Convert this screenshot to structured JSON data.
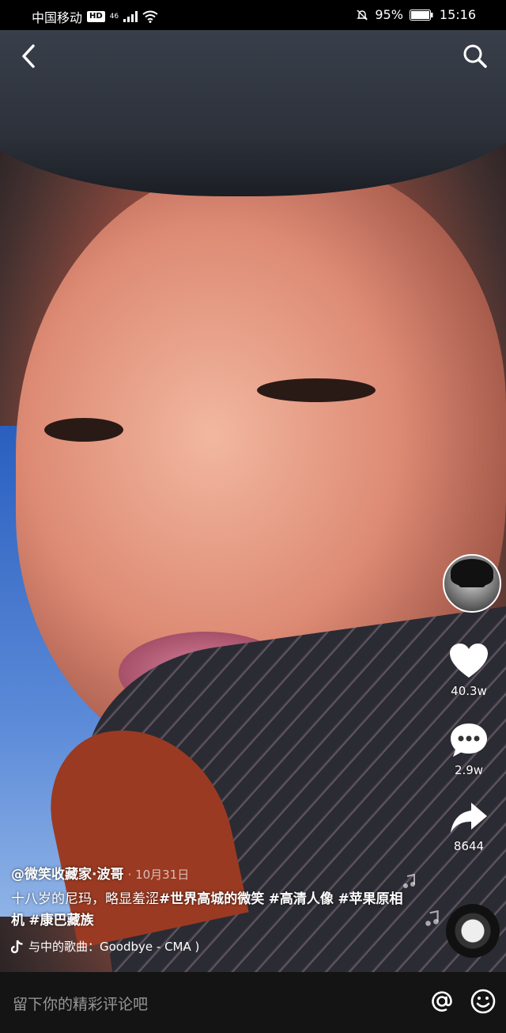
{
  "status_bar": {
    "carrier": "中国移动",
    "hd": "HD",
    "network": "46",
    "battery": "95%",
    "time": "15:16"
  },
  "actions": {
    "likes": "40.3w",
    "comments": "2.9w",
    "shares": "8644"
  },
  "post": {
    "author": "@微笑收藏家·波哥",
    "date": "· 10月31日",
    "caption_plain": "十八岁的尼玛，略显羞涩",
    "tags": [
      "#世界高城的微笑",
      "#高清人像",
      "#苹果原相机",
      "#康巴藏族"
    ],
    "music": "与中的歌曲：Goodbye - CMA )"
  },
  "comment_bar": {
    "placeholder": "留下你的精彩评论吧"
  },
  "icons": {
    "back": "chevron-left-icon",
    "search": "search-icon",
    "like": "heart-icon",
    "comment": "comment-icon",
    "share": "share-arrow-icon",
    "music": "tiktok-note-icon",
    "at": "at-icon",
    "emoji": "smiley-icon"
  }
}
